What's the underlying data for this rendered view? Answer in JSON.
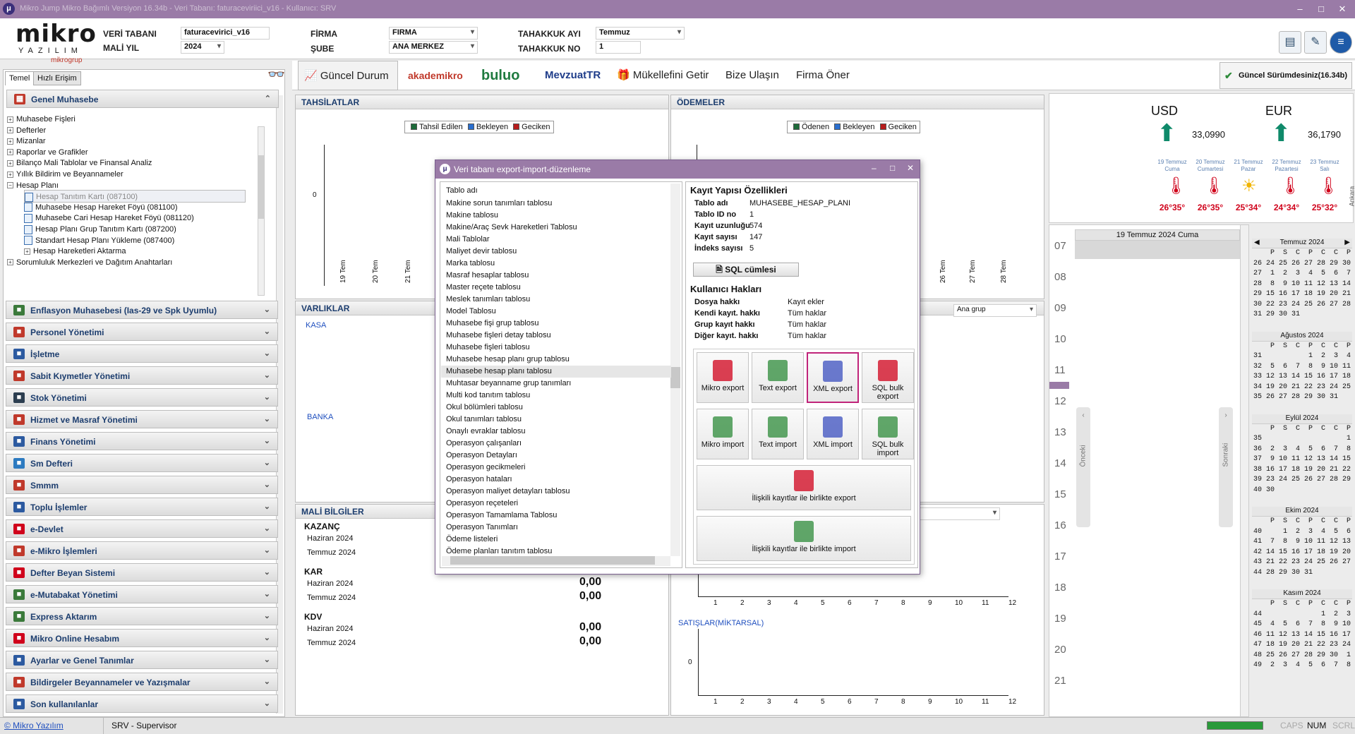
{
  "window": {
    "title": "Mikro Jump Mikro Bağımlı Versiyon 16.34b - Veri Tabanı: faturaceviriici_v16 - Kullanıcı: SRV",
    "controls": [
      "–",
      "□",
      "✕"
    ]
  },
  "header": {
    "logo_main": "mikro",
    "logo_sub": "YAZILIM",
    "logo_group": "mikrogrup",
    "veri_tabani_label": "VERİ TABANI",
    "veri_tabani_value": "faturacevirici_v16",
    "mali_yil_label": "MALİ YIL",
    "mali_yil_value": "2024",
    "firma_label": "FİRMA",
    "firma_value": "FIRMA",
    "sube_label": "ŞUBE",
    "sube_value": "ANA MERKEZ",
    "tahakkuk_ayi_label": "TAHAKKUK AYI",
    "tahakkuk_ayi_value": "Temmuz",
    "tahakkuk_no_label": "TAHAKKUK NO",
    "tahakkuk_no_value": "1"
  },
  "left": {
    "tabs": [
      "Temel",
      "Hızlı Erişim"
    ],
    "open_section": "Genel Muhasebe",
    "tree": [
      {
        "label": "Muhasebe Fişleri",
        "level": 0,
        "type": "folder"
      },
      {
        "label": "Defterler",
        "level": 0,
        "type": "folder"
      },
      {
        "label": "Mizanlar",
        "level": 0,
        "type": "folder"
      },
      {
        "label": "Raporlar ve Grafikler",
        "level": 0,
        "type": "folder"
      },
      {
        "label": "Bilanço Mali Tablolar ve Finansal Analiz",
        "level": 0,
        "type": "folder"
      },
      {
        "label": "Yıllık Bildirim ve Beyannameler",
        "level": 0,
        "type": "folder"
      },
      {
        "label": "Hesap Planı",
        "level": 0,
        "type": "open"
      },
      {
        "label": "Hesap Tanıtım Kartı (087100)",
        "level": 1,
        "type": "doc"
      },
      {
        "label": "Muhasebe Hesap Hareket Föyü (081100)",
        "level": 1,
        "type": "doc"
      },
      {
        "label": "Muhasebe Cari Hesap Hareket Föyü (081120)",
        "level": 1,
        "type": "doc"
      },
      {
        "label": "Hesap Planı Grup Tanıtım Kartı (087200)",
        "level": 1,
        "type": "doc"
      },
      {
        "label": "Standart Hesap Planı Yükleme (087400)",
        "level": 1,
        "type": "doc"
      },
      {
        "label": "Hesap Hareketleri Aktarma",
        "level": 1,
        "type": "folder"
      },
      {
        "label": "Sorumluluk Merkezleri ve Dağıtım Anahtarları",
        "level": 0,
        "type": "folder"
      }
    ],
    "sections": [
      {
        "label": "Enflasyon Muhasebesi (Ias-29 ve Spk Uyumlu)",
        "color": "#3b7a3b"
      },
      {
        "label": "Personel Yönetimi",
        "color": "#c0392b"
      },
      {
        "label": "İşletme",
        "color": "#2c5aa0"
      },
      {
        "label": "Sabit Kıymetler Yönetimi",
        "color": "#c0392b"
      },
      {
        "label": "Stok Yönetimi",
        "color": "#2c3e50"
      },
      {
        "label": "Hizmet ve Masraf Yönetimi",
        "color": "#c0392b"
      },
      {
        "label": "Finans Yönetimi",
        "color": "#2c5aa0"
      },
      {
        "label": "Sm Defteri",
        "color": "#2c7ac0"
      },
      {
        "label": "Smmm",
        "color": "#c0392b"
      },
      {
        "label": "Toplu İşlemler",
        "color": "#2c5aa0"
      },
      {
        "label": "e-Devlet",
        "color": "#d0021b"
      },
      {
        "label": "e-Mikro İşlemleri",
        "color": "#c0392b"
      },
      {
        "label": "Defter Beyan Sistemi",
        "color": "#d0021b"
      },
      {
        "label": "e-Mutabakat Yönetimi",
        "color": "#3b7a3b"
      },
      {
        "label": "Express Aktarım",
        "color": "#3b7a3b"
      },
      {
        "label": "Mikro Online Hesabım",
        "color": "#d0021b"
      },
      {
        "label": "Ayarlar ve Genel Tanımlar",
        "color": "#2c5aa0"
      },
      {
        "label": "Bildirgeler Beyannameler ve Yazışmalar",
        "color": "#c0392b"
      },
      {
        "label": "Son kullanılanlar",
        "color": "#2c5aa0"
      }
    ]
  },
  "nav": {
    "items": [
      "Güncel Durum",
      "akademikro",
      "buluo",
      "MevzuatTR",
      "Mükellefini Getir",
      "Bize Ulaşın",
      "Firma Öner"
    ],
    "version": "Güncel Sürümdesiniz(16.34b)"
  },
  "tahsilatlar": {
    "title": "TAHSİLATLAR",
    "legend": [
      "Tahsil Edilen",
      "Bekleyen",
      "Geciken"
    ],
    "zero": "0",
    "dates": [
      "19 Tem",
      "20 Tem",
      "21 Tem"
    ]
  },
  "odemeler": {
    "title": "ÖDEMELER",
    "legend": [
      "Ödenen",
      "Bekleyen",
      "Geciken"
    ],
    "dates": [
      "26 Tem",
      "27 Tem",
      "28 Tem"
    ]
  },
  "varliklar": {
    "title": "VARLIKLAR",
    "kasa": "KASA",
    "banka": "BANKA",
    "combo": "Ana grup"
  },
  "mali": {
    "title": "MALİ BİLGİLER",
    "groups": [
      {
        "name": "KAZANÇ",
        "rows": [
          {
            "label": "Haziran 2024",
            "value": ""
          },
          {
            "label": "Temmuz 2024",
            "value": ""
          }
        ]
      },
      {
        "name": "KAR",
        "rows": [
          {
            "label": "Haziran 2024",
            "value": "0,00"
          },
          {
            "label": "Temmuz 2024",
            "value": "0,00"
          }
        ]
      },
      {
        "name": "KDV",
        "rows": [
          {
            "label": "Haziran 2024",
            "value": "0,00"
          },
          {
            "label": "Temmuz 2024",
            "value": "0,00"
          }
        ]
      }
    ]
  },
  "right_charts": {
    "months": [
      "1",
      "2",
      "3",
      "4",
      "5",
      "6",
      "7",
      "8",
      "9",
      "10",
      "11",
      "12"
    ],
    "satis_label": "SATIŞLAR(MİKTARSAL)",
    "zero": "0"
  },
  "currency": {
    "usd": {
      "label": "USD",
      "value": "33,0990"
    },
    "eur": {
      "label": "EUR",
      "value": "36,1790"
    }
  },
  "weather": [
    {
      "day": "19 Temmuz",
      "name": "Cuma",
      "temp": "26°35°",
      "icon": "thermometer"
    },
    {
      "day": "20 Temmuz",
      "name": "Cumartesi",
      "temp": "26°35°",
      "icon": "thermometer"
    },
    {
      "day": "21 Temmuz",
      "name": "Pazar",
      "temp": "25°34°",
      "icon": "sun"
    },
    {
      "day": "22 Temmuz",
      "name": "Pazartesi",
      "temp": "24°34°",
      "icon": "thermometer"
    },
    {
      "day": "23 Temmuz",
      "name": "Salı",
      "temp": "25°32°",
      "icon": "thermometer"
    }
  ],
  "weather_side": "Ankara",
  "agenda": {
    "date": "19 Temmuz 2024 Cuma",
    "hours": [
      "07",
      "08",
      "09",
      "10",
      "11",
      "12",
      "13",
      "14",
      "15",
      "16",
      "17",
      "18",
      "19",
      "20",
      "21"
    ],
    "prev": "Önceki",
    "next": "Sonraki"
  },
  "calendar": [
    {
      "title": "Temmuz 2024",
      "rows": [
        "    P  S  C  P  C  C  P",
        "26 24 25 26 27 28 29 30",
        "27  1  2  3  4  5  6  7",
        "28  8  9 10 11 12 13 14",
        "29 15 16 17 18 19 20 21",
        "30 22 23 24 25 26 27 28",
        "31 29 30 31"
      ]
    },
    {
      "title": "Ağustos 2024",
      "rows": [
        "    P  S  C  P  C  C  P",
        "31           1  2  3  4",
        "32  5  6  7  8  9 10 11",
        "33 12 13 14 15 16 17 18",
        "34 19 20 21 22 23 24 25",
        "35 26 27 28 29 30 31"
      ]
    },
    {
      "title": "Eylül 2024",
      "rows": [
        "    P  S  C  P  C  C  P",
        "35                    1",
        "36  2  3  4  5  6  7  8",
        "37  9 10 11 12 13 14 15",
        "38 16 17 18 19 20 21 22",
        "39 23 24 25 26 27 28 29",
        "40 30"
      ]
    },
    {
      "title": "Ekim 2024",
      "rows": [
        "    P  S  C  P  C  C  P",
        "40     1  2  3  4  5  6",
        "41  7  8  9 10 11 12 13",
        "42 14 15 16 17 18 19 20",
        "43 21 22 23 24 25 26 27",
        "44 28 29 30 31"
      ]
    },
    {
      "title": "Kasım 2024",
      "rows": [
        "    P  S  C  P  C  C  P",
        "44              1  2  3",
        "45  4  5  6  7  8  9 10",
        "46 11 12 13 14 15 16 17",
        "47 18 19 20 21 22 23 24",
        "48 25 26 27 28 29 30  1",
        "49  2  3  4  5  6  7  8"
      ]
    }
  ],
  "dialog": {
    "title": "Veri tabanı export-import-düzenleme",
    "list_header": "Tablo adı",
    "tables": [
      "Makine sorun tanımları tablosu",
      "Makine tablosu",
      "Makine/Araç Sevk Hareketleri Tablosu",
      "Mali Tablolar",
      "Maliyet devir tablosu",
      "Marka tablosu",
      "Masraf hesaplar tablosu",
      "Master reçete tablosu",
      "Meslek tanımları tablosu",
      "Model Tablosu",
      "Muhasebe fişi grup tablosu",
      "Muhasebe fişleri detay tablosu",
      "Muhasebe fişleri tablosu",
      "Muhasebe hesap planı grup tablosu",
      "Muhasebe hesap planı tablosu",
      "Muhtasar beyanname grup tanımları",
      "Multi kod tanıtım tablosu",
      "Okul bölümleri tablosu",
      "Okul tanımları tablosu",
      "Onaylı evraklar tablosu",
      "Operasyon çalışanları",
      "Operasyon Detayları",
      "Operasyon gecikmeleri",
      "Operasyon hataları",
      "Operasyon maliyet detayları tablosu",
      "Operasyon reçeteleri",
      "Operasyon Tamamlama Tablosu",
      "Operasyon Tanımları",
      "Ödeme listeleri",
      "Ödeme planları tanıtım tablosu"
    ],
    "selected_index": 14,
    "props_title": "Kayıt Yapısı Özellikleri",
    "props": [
      {
        "k": "Tablo adı",
        "v": "MUHASEBE_HESAP_PLANI"
      },
      {
        "k": "Tablo ID no",
        "v": "1"
      },
      {
        "k": "Kayıt uzunluğu",
        "v": "574"
      },
      {
        "k": "Kayıt sayısı",
        "v": "147"
      },
      {
        "k": "İndeks sayısı",
        "v": "5"
      }
    ],
    "sql_button": "SQL cümlesi",
    "rights_title": "Kullanıcı Hakları",
    "rights": [
      {
        "k": "Dosya hakkı",
        "v": "Kayıt ekler"
      },
      {
        "k": "Kendi kayıt. hakkı",
        "v": "Tüm haklar"
      },
      {
        "k": "Grup kayıt hakkı",
        "v": "Tüm haklar"
      },
      {
        "k": "Diğer kayıt. hakkı",
        "v": "Tüm haklar"
      }
    ],
    "buttons": [
      "Mikro export",
      "Text export",
      "XML export",
      "SQL bulk export",
      "Mikro import",
      "Text import",
      "XML import",
      "SQL bulk import"
    ],
    "wide_buttons": [
      "İlişkili kayıtlar ile birlikte export",
      "İlişkili kayıtlar ile birlikte import"
    ]
  },
  "status": {
    "copyright": "© Mikro Yazılım",
    "user": "SRV - Supervisor",
    "caps": "CAPS",
    "num": "NUM",
    "scrl": "SCRL"
  }
}
